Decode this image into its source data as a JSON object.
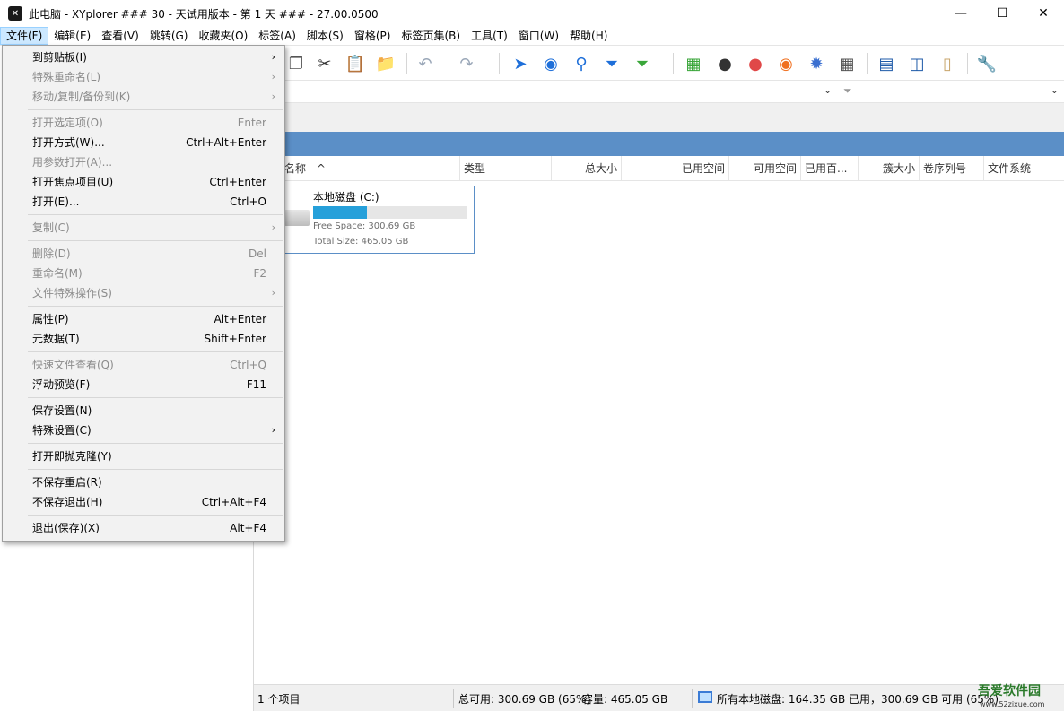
{
  "window": {
    "title": "此电脑 - XYplorer ### 30 - 天试用版本 - 第 1 天 ### - 27.00.0500",
    "app_icon": "xyplorer-logo-icon",
    "controls": [
      "minimize-icon",
      "maximize-icon",
      "close-icon"
    ]
  },
  "menubar": {
    "items": [
      "文件(F)",
      "编辑(E)",
      "查看(V)",
      "跳转(G)",
      "收藏夹(O)",
      "标签(A)",
      "脚本(S)",
      "窗格(P)",
      "标签页集(B)",
      "工具(T)",
      "窗口(W)",
      "帮助(H)"
    ],
    "active_index": 0
  },
  "file_menu": {
    "items": [
      {
        "label": "到剪贴板(I)",
        "shortcut": "",
        "submenu": true,
        "disabled": false
      },
      {
        "label": "特殊重命名(L)",
        "shortcut": "",
        "submenu": true,
        "disabled": true
      },
      {
        "label": "移动/复制/备份到(K)",
        "shortcut": "",
        "submenu": true,
        "disabled": true
      },
      {
        "sep": true
      },
      {
        "label": "打开选定项(O)",
        "shortcut": "Enter",
        "submenu": false,
        "disabled": true
      },
      {
        "label": "打开方式(W)...",
        "shortcut": "Ctrl+Alt+Enter",
        "submenu": false,
        "disabled": false
      },
      {
        "label": "用参数打开(A)...",
        "shortcut": "",
        "submenu": false,
        "disabled": true
      },
      {
        "label": "打开焦点项目(U)",
        "shortcut": "Ctrl+Enter",
        "submenu": false,
        "disabled": false
      },
      {
        "label": "打开(E)...",
        "shortcut": "Ctrl+O",
        "submenu": false,
        "disabled": false
      },
      {
        "sep": true
      },
      {
        "label": "复制(C)",
        "shortcut": "",
        "submenu": true,
        "disabled": true
      },
      {
        "sep": true
      },
      {
        "label": "删除(D)",
        "shortcut": "Del",
        "submenu": false,
        "disabled": true
      },
      {
        "label": "重命名(M)",
        "shortcut": "F2",
        "submenu": false,
        "disabled": true
      },
      {
        "label": "文件特殊操作(S)",
        "shortcut": "",
        "submenu": true,
        "disabled": true
      },
      {
        "sep": true
      },
      {
        "label": "属性(P)",
        "shortcut": "Alt+Enter",
        "submenu": false,
        "disabled": false
      },
      {
        "label": "元数据(T)",
        "shortcut": "Shift+Enter",
        "submenu": false,
        "disabled": false
      },
      {
        "sep": true
      },
      {
        "label": "快速文件查看(Q)",
        "shortcut": "Ctrl+Q",
        "submenu": false,
        "disabled": true
      },
      {
        "label": "浮动预览(F)",
        "shortcut": "F11",
        "submenu": false,
        "disabled": false
      },
      {
        "sep": true
      },
      {
        "label": "保存设置(N)",
        "shortcut": "",
        "submenu": false,
        "disabled": false
      },
      {
        "label": "特殊设置(C)",
        "shortcut": "",
        "submenu": true,
        "disabled": false
      },
      {
        "sep": true
      },
      {
        "label": "打开即抛克隆(Y)",
        "shortcut": "",
        "submenu": false,
        "disabled": false
      },
      {
        "sep": true
      },
      {
        "label": "不保存重启(R)",
        "shortcut": "",
        "submenu": false,
        "disabled": false
      },
      {
        "label": "不保存退出(H)",
        "shortcut": "Ctrl+Alt+F4",
        "submenu": false,
        "disabled": false
      },
      {
        "sep": true
      },
      {
        "label": "退出(保存)(X)",
        "shortcut": "Alt+F4",
        "submenu": false,
        "disabled": false
      }
    ]
  },
  "columns": [
    "名称",
    "类型",
    "总大小",
    "已用空间",
    "可用空间",
    "已用百...",
    "簇大小",
    "卷序列号",
    "文件系统"
  ],
  "sort_indicator": "^",
  "drive": {
    "name": "本地磁盘 (C:)",
    "used_fraction": 0.35,
    "free": "Free Space: 300.69 GB",
    "total": "Total Size: 465.05 GB"
  },
  "status": {
    "count": "1 个项目",
    "free": "总可用: 300.69 GB (65%)",
    "capacity": "容量: 465.05 GB",
    "all_drives": "所有本地磁盘: 164.35 GB 已用，300.69 GB 可用 (65%)"
  },
  "watermark": {
    "main": "吾爱软件园",
    "url": "www.52zixue.com"
  },
  "colors": {
    "accent": "#5b8fc7",
    "bar_fill": "#26a0da",
    "menu_active": "#cce8ff"
  }
}
